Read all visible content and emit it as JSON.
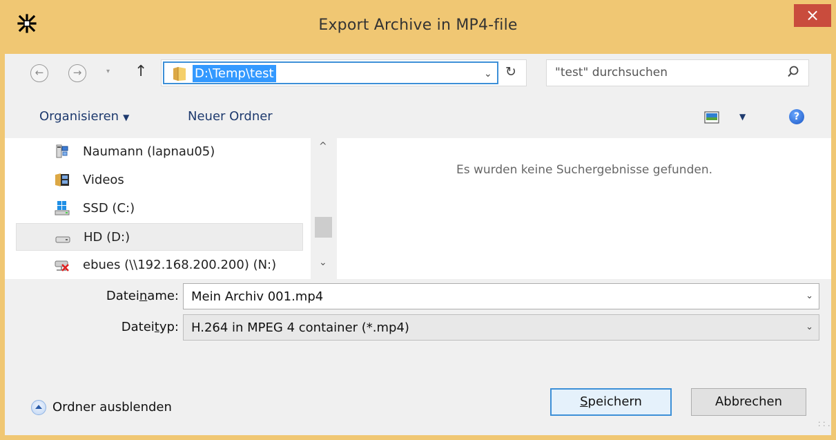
{
  "window": {
    "title": "Export Archive in MP4-file",
    "close_label": "×"
  },
  "nav": {
    "back_label": "←",
    "forward_label": "→",
    "history_label": "▾",
    "up_label": "↑",
    "address_path": "D:\\Temp\\test",
    "address_dropdown": "⌄",
    "refresh_label": "↻",
    "search_placeholder": "\"test\" durchsuchen"
  },
  "toolbar": {
    "organize_label": "Organisieren",
    "organize_caret": "▼",
    "new_folder_label": "Neuer Ordner",
    "view_caret": "▼",
    "help_label": "?"
  },
  "sidebar": {
    "items": [
      {
        "label": "Naumann (lapnau05)",
        "icon": "network-user-icon",
        "selected": false
      },
      {
        "label": "Videos",
        "icon": "videos-folder-icon",
        "selected": false
      },
      {
        "label": "SSD (C:)",
        "icon": "windows-drive-icon",
        "selected": false
      },
      {
        "label": "HD (D:)",
        "icon": "hard-drive-icon",
        "selected": true
      },
      {
        "label": "ebues (\\\\192.168.200.200) (N:)",
        "icon": "disconnected-network-drive-icon",
        "selected": false
      }
    ],
    "scroll_up": "^",
    "scroll_down": "⌄"
  },
  "results": {
    "empty_message": "Es wurden keine Suchergebnisse gefunden."
  },
  "form": {
    "filename_label_pre": "Datei",
    "filename_label_accel": "n",
    "filename_label_post": "ame:",
    "filename_value": "Mein Archiv 001.mp4",
    "filetype_label_pre": "Datei",
    "filetype_label_accel": "t",
    "filetype_label_post": "yp:",
    "filetype_value": "H.264 in MPEG 4 container (*.mp4)",
    "dropdown_glyph": "⌄"
  },
  "footer": {
    "hide_folders_label": "Ordner ausblenden",
    "save_accel": "S",
    "save_rest": "peichern",
    "cancel_label": "Abbrechen"
  },
  "colors": {
    "title_bar": "#f0c773",
    "close_button": "#c94c3d",
    "selection": "#3399ff",
    "focus_border": "#3c8fd7"
  }
}
